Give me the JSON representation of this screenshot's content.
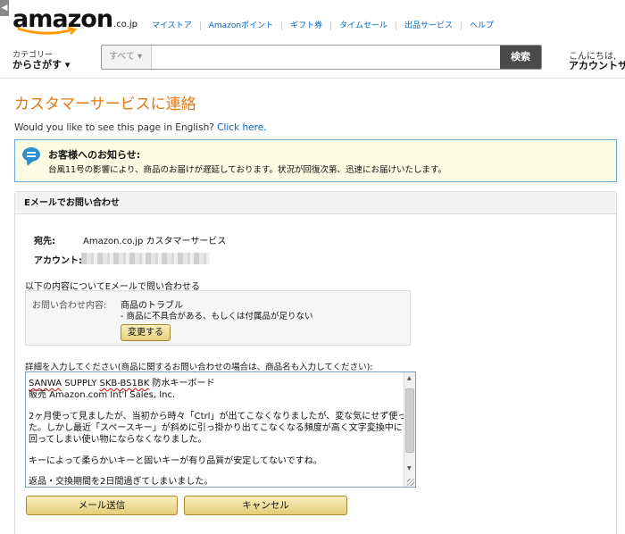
{
  "header": {
    "side_tab": "◀",
    "logo_text": "amazon",
    "logo_tld": ".co.jp",
    "nav": [
      "マイストア",
      "Amazonポイント",
      "ギフト券",
      "タイムセール",
      "出品サービス",
      "ヘルプ"
    ],
    "category_small": "カテゴリー",
    "category_big": "からさがす ▾",
    "search_scope": "すべて ▾",
    "search_value": "",
    "search_button": "検索",
    "greeting_small": "こんにちは,",
    "greeting_big": "アカウントサ"
  },
  "page": {
    "title": "カスタマーサービスに連絡",
    "english_prompt": "Would you like to see this page in English?",
    "english_link": "Click here."
  },
  "notice": {
    "title": "お客様へのお知らせ:",
    "body": "台風11号の影響により、商品のお届けが遅延しております。状況が回復次第、迅速にお届けいたします。"
  },
  "form": {
    "section_title": "Eメールでお問い合わせ",
    "to_label": "宛先:",
    "to_value": "Amazon.co.jp カスタマーサービス",
    "account_label": "アカウント:",
    "inquiry_label": "以下の内容についてEメールで問い合わせる",
    "inquiry_key": "お問い合わせ内容:",
    "inquiry_value_1": "商品のトラブル",
    "inquiry_value_2": "- 商品に不具合がある、もしくは付属品が足りない",
    "change_button": "変更する",
    "detail_label": "詳細を入力してください(商品に関するお問い合わせの場合は、商品名も入力してください):",
    "message": {
      "line1_a": "SANWA",
      "line1_b": " SUPPLY ",
      "line1_c": "SKB-BS1BK",
      "line1_d": " 防水キーボード",
      "line2": "販売 Amazon.com Int'l Sales, Inc.",
      "line3": "2ヶ月使って見ましたが、当初から時々「Ctrl」が出てこなくなりましたが、変な気にせず使っていまし",
      "line4": "た。しかし最近「スペースキー」が斜めに引っ掛かり出てこなくなる頻度が高く文字変換中にクルクル",
      "line5": "回ってしまい使い物にならなくなりました。",
      "line6": "キーによって柔らかいキーと固いキーが有り品質が安定してないですね。",
      "line7": "返品・交換期間を2日間過ぎてしまいました。"
    },
    "send_button": "メール送信",
    "cancel_button": "キャンセル"
  },
  "colors": {
    "title_orange": "#e47911",
    "link_blue": "#0066c0",
    "notice_bg": "#fcfbe3",
    "notice_border": "#6aa8d6",
    "button_gold": "#e5cd78"
  }
}
